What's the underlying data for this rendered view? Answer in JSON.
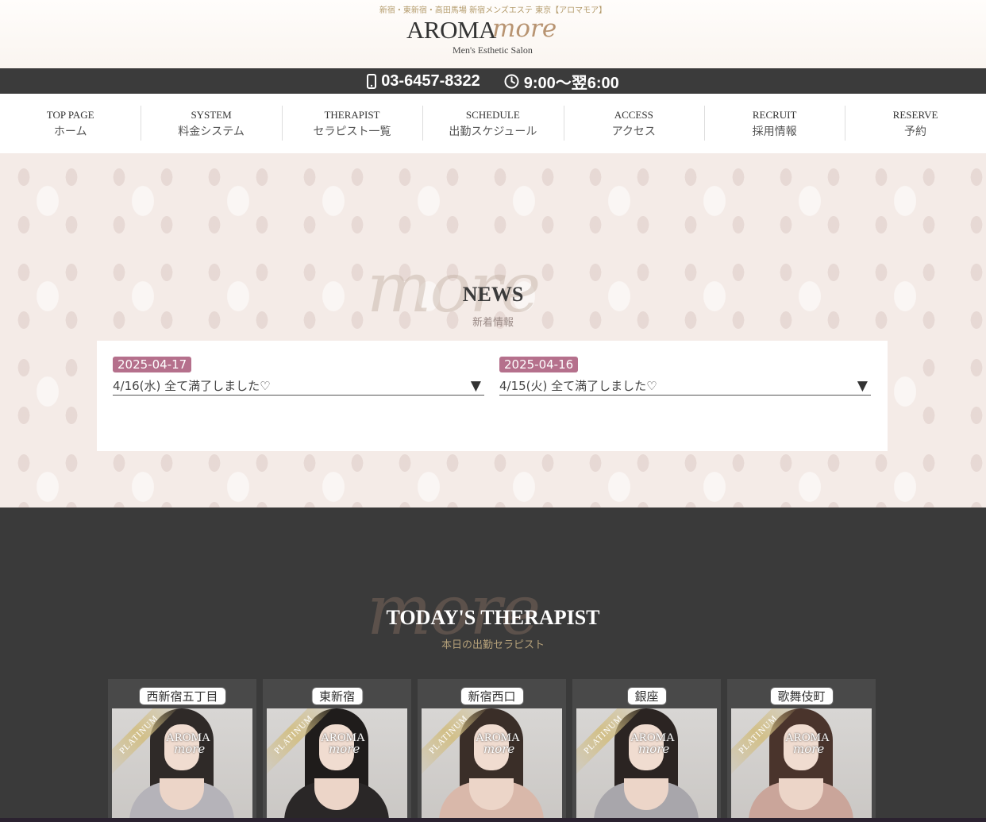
{
  "header": {
    "tagline": "新宿・東新宿・高田馬場 新宿メンズエステ 東京【アロマモア】",
    "logo_main": "AROMA",
    "logo_script": "more",
    "logo_sub": "Men's Esthetic Salon"
  },
  "contact": {
    "phone": "03-6457-8322",
    "hours": "9:00〜翌6:00",
    "phone_icon": "smartphone-icon",
    "hours_icon": "clock-icon"
  },
  "nav": [
    {
      "en": "TOP PAGE",
      "jp": "ホーム"
    },
    {
      "en": "SYSTEM",
      "jp": "料金システム"
    },
    {
      "en": "THERAPIST",
      "jp": "セラピスト一覧"
    },
    {
      "en": "SCHEDULE",
      "jp": "出勤スケジュール"
    },
    {
      "en": "ACCESS",
      "jp": "アクセス"
    },
    {
      "en": "RECRUIT",
      "jp": "採用情報"
    },
    {
      "en": "RESERVE",
      "jp": "予約"
    }
  ],
  "news": {
    "script": "more",
    "title": "NEWS",
    "subtitle": "新着情報",
    "items": [
      {
        "date": "2025-04-17",
        "text": "4/16(水) 全て満了しました♡",
        "toggle": "▼"
      },
      {
        "date": "2025-04-16",
        "text": "4/15(火) 全て満了しました♡",
        "toggle": "▼"
      }
    ]
  },
  "therapist": {
    "script": "more",
    "title": "TODAY'S THERAPIST",
    "subtitle": "本日の出勤セラピスト",
    "rank": "PLATINUM",
    "watermark_main": "AROMA",
    "watermark_script": "more",
    "cards": [
      {
        "area": "西新宿五丁目",
        "hair": "#2f2a28",
        "top": "#b5b3b9"
      },
      {
        "area": "東新宿",
        "hair": "#1f1c1b",
        "top": "#2a2727"
      },
      {
        "area": "新宿西口",
        "hair": "#3a2e28",
        "top": "#d9b8aa"
      },
      {
        "area": "銀座",
        "hair": "#2b2422",
        "top": "#a8a6ab"
      },
      {
        "area": "歌舞伎町",
        "hair": "#4a342c",
        "top": "#caa59a"
      }
    ]
  },
  "colors": {
    "accent": "#b5708c",
    "dark": "#3a3a3a",
    "gold": "#b4a079"
  }
}
